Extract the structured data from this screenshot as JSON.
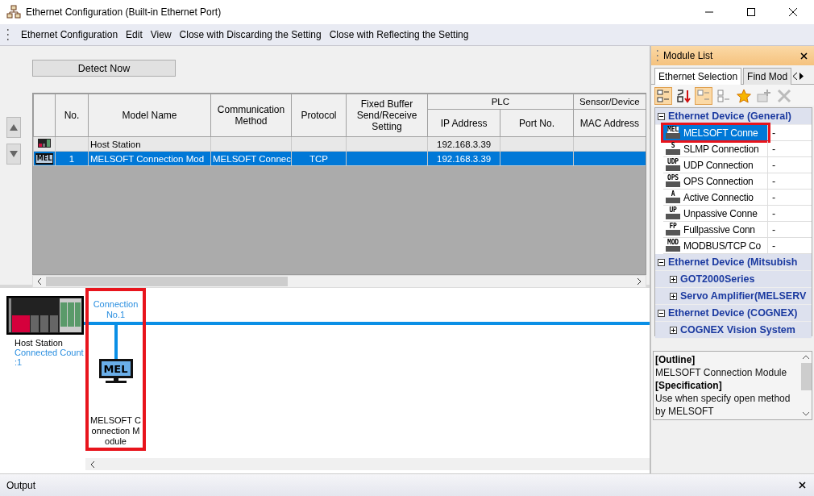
{
  "window": {
    "title": "Ethernet Configuration (Built-in Ethernet Port)"
  },
  "menu": [
    "Ethernet Configuration",
    "Edit",
    "View",
    "Close with Discarding the Setting",
    "Close with Reflecting the Setting"
  ],
  "detect_button": "Detect Now",
  "table": {
    "columns": [
      {
        "label": "No."
      },
      {
        "label": "Model Name"
      },
      {
        "label": "Communication Method"
      },
      {
        "label": "Protocol"
      },
      {
        "label": "Fixed Buffer Send/Receive Setting"
      },
      {
        "group": "PLC",
        "columns": [
          {
            "label": "IP Address"
          },
          {
            "label": "Port No."
          }
        ]
      },
      {
        "group": "Sensor/Device",
        "columns": [
          {
            "label": "MAC Address"
          }
        ]
      }
    ],
    "rows": [
      {
        "kind": "host",
        "selected": false,
        "model_name": "Host Station",
        "ip_address": "192.168.3.39"
      },
      {
        "kind": "module",
        "selected": true,
        "icon_text": "MEL",
        "no": "1",
        "model_name": "MELSOFT Connection Mod",
        "communication_method": "MELSOFT Connec",
        "protocol": "TCP",
        "ip_address": "192.168.3.39"
      }
    ]
  },
  "diagram": {
    "host": {
      "label": "Host Station",
      "connected_count": "Connected Count :1"
    },
    "connections": [
      {
        "label": "Connection No.1",
        "icon_text": "MEL",
        "module_name": "MELSOFT Connection Module",
        "selected": true
      }
    ]
  },
  "module_list": {
    "title": "Module List",
    "tabs": [
      {
        "label": "Ethernet Selection",
        "selected": true
      },
      {
        "label": "Find Mod",
        "selected": false
      }
    ],
    "tree": [
      {
        "label": "Ethernet Device (General)",
        "expanded": true,
        "children": [
          {
            "label": "MELSOFT Conne",
            "icon_text": "MEL",
            "value": "-",
            "selected": true
          },
          {
            "label": "SLMP Connection",
            "icon_text": "S",
            "value": "-",
            "selected": false
          },
          {
            "label": "UDP Connection",
            "icon_text": "UDP",
            "value": "-",
            "selected": false
          },
          {
            "label": "OPS Connection",
            "icon_text": "OPS",
            "value": "-",
            "selected": false
          },
          {
            "label": "Active Connectio",
            "icon_text": "A",
            "value": "-",
            "selected": false
          },
          {
            "label": "Unpassive Conne",
            "icon_text": "UP",
            "value": "-",
            "selected": false
          },
          {
            "label": "Fullpassive Conn",
            "icon_text": "FP",
            "value": "-",
            "selected": false
          },
          {
            "label": "MODBUS/TCP Co",
            "icon_text": "MOD",
            "value": "-",
            "selected": false
          }
        ]
      },
      {
        "label": "Ethernet Device (Mitsubish",
        "expanded": true,
        "groups": [
          {
            "label": "GOT2000Series",
            "expanded": false
          },
          {
            "label": "Servo Amplifier(MELSERV",
            "expanded": false
          }
        ]
      },
      {
        "label": "Ethernet Device (COGNEX)",
        "expanded": true,
        "groups": [
          {
            "label": "COGNEX Vision System",
            "expanded": false
          }
        ]
      }
    ],
    "info": [
      {
        "kind": "heading",
        "text": "[Outline]"
      },
      {
        "kind": "text",
        "text": "MELSOFT Connection Module"
      },
      {
        "kind": "heading",
        "text": "[Specification]"
      },
      {
        "kind": "text",
        "text": "Use when specify open method by MELSOFT"
      }
    ]
  },
  "output": {
    "title": "Output"
  }
}
